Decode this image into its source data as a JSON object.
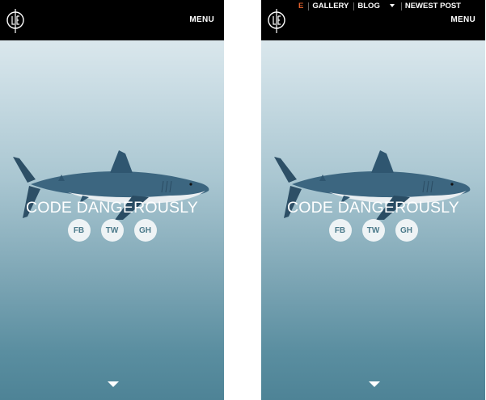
{
  "header": {
    "menu_label": "MENU"
  },
  "nav": {
    "items": [
      {
        "label": "E"
      },
      {
        "label": "GALLERY"
      },
      {
        "label": "BLOG"
      },
      {
        "label": "NEWEST POST"
      }
    ],
    "accent_color": "#e0602b"
  },
  "hero": {
    "headline": "CODE DANGEROUSLY",
    "socials": [
      {
        "label": "FB"
      },
      {
        "label": "TW"
      },
      {
        "label": "GH"
      }
    ]
  },
  "icons": {
    "logo": "monogram-logo",
    "hero_image": "shark-image",
    "scroll": "caret-down-icon",
    "nav_dropdown": "caret-down-icon"
  }
}
